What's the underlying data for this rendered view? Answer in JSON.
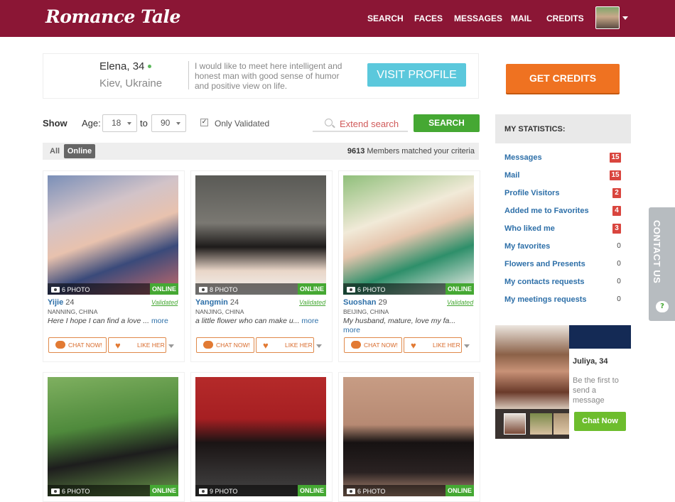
{
  "header": {
    "logo": "Romance Tale",
    "nav": [
      "SEARCH",
      "FACES",
      "MESSAGES",
      "MAIL",
      "CREDITS"
    ]
  },
  "featured": {
    "name": "Elena, 34",
    "location": "Kiev, Ukraine",
    "message": "I would like to meet here intelligent and honest man with good sense of humor and positive view on life.",
    "button": "VISIT PROFILE"
  },
  "filters": {
    "show": "Show",
    "age_label": "Age:",
    "age_from": "18",
    "to": "to",
    "age_to": "90",
    "validated_label": "Only Validated",
    "validated_checked": true,
    "extend_search": "Extend search",
    "search_button": "SEARCH"
  },
  "tabs": {
    "all": "All",
    "online": "Online",
    "matched_count": "9613",
    "matched_text": "Members matched your criteria"
  },
  "profiles": [
    {
      "name": "Yijie",
      "age": "24",
      "photos": "6 PHOTO",
      "status": "ONLINE",
      "validated": "Validated",
      "city": "NANNING, CHINA",
      "desc": "Here I hope I can find a love ...",
      "more": "more",
      "chat": "CHAT NOW!",
      "like": "LIKE HER"
    },
    {
      "name": "Yangmin",
      "age": "24",
      "photos": "8 PHOTO",
      "status": "ONLINE",
      "validated": "Validated",
      "city": "NANJING, CHINA",
      "desc": "a little flower who can make u...",
      "more": "more",
      "chat": "CHAT NOW!",
      "like": "LIKE HER"
    },
    {
      "name": "Suoshan",
      "age": "29",
      "photos": "6 PHOTO",
      "status": "ONLINE",
      "validated": "Validated",
      "city": "BEIJING, CHINA",
      "desc": "My husband, mature, love my fa...",
      "more": "more",
      "chat": "CHAT NOW!",
      "like": "LIKE HER"
    },
    {
      "photos": "6 PHOTO",
      "status": "ONLINE"
    },
    {
      "photos": "9 PHOTO",
      "status": "ONLINE"
    },
    {
      "photos": "6 PHOTO",
      "status": "ONLINE"
    }
  ],
  "sidebar": {
    "get_credits": "GET CREDITS",
    "stats_title": "MY STATISTICS:",
    "stats": [
      {
        "label": "Messages",
        "value": "15"
      },
      {
        "label": "Mail",
        "value": "15"
      },
      {
        "label": "Profile Visitors",
        "value": "2"
      },
      {
        "label": "Added me to Favorites",
        "value": "4"
      },
      {
        "label": "Who liked me",
        "value": "3"
      },
      {
        "label": "My favorites",
        "value": "0"
      },
      {
        "label": "Flowers and Presents",
        "value": "0"
      },
      {
        "label": "My contacts requests",
        "value": "0"
      },
      {
        "label": "My meetings requests",
        "value": "0"
      }
    ],
    "contact_us": "CONTACT US",
    "promo": {
      "name": "Juliya, 34",
      "message": "Be the first to send a message",
      "chat_button": "Chat Now"
    }
  },
  "colors": {
    "brand": "#8b1635",
    "accent_green": "#45a833",
    "accent_orange": "#ef7221",
    "visit_blue": "#5bc8dc",
    "badge_red": "#d9453e"
  }
}
